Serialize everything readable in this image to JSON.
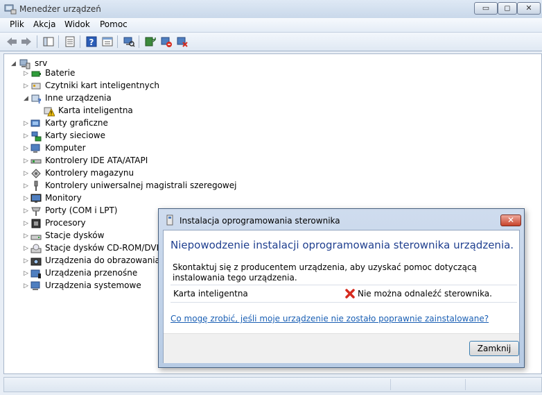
{
  "window": {
    "title": "Menedżer urządzeń",
    "controls": {
      "minimize": "▭",
      "maximize": "◻",
      "close": "✕"
    }
  },
  "menu": {
    "items": [
      "Plik",
      "Akcja",
      "Widok",
      "Pomoc"
    ]
  },
  "toolbar": {
    "icons": [
      "back-arrow-icon",
      "forward-arrow-icon",
      "show-hide-console-tree-icon",
      "properties-icon",
      "help-icon",
      "view-icon",
      "scan-hardware-icon",
      "update-driver-icon",
      "disable-device-icon",
      "uninstall-device-icon"
    ]
  },
  "tree": {
    "root": "srv",
    "nodes": [
      {
        "label": "Baterie",
        "icon": "battery-icon"
      },
      {
        "label": "Czytniki kart inteligentnych",
        "icon": "smartcard-reader-icon"
      },
      {
        "label": "Inne urządzenia",
        "icon": "unknown-device-icon",
        "expanded": true
      },
      {
        "label": "Karta inteligentna",
        "icon": "warning-device-icon",
        "child": true
      },
      {
        "label": "Karty graficzne",
        "icon": "display-adapter-icon"
      },
      {
        "label": "Karty sieciowe",
        "icon": "network-adapter-icon"
      },
      {
        "label": "Komputer",
        "icon": "computer-icon"
      },
      {
        "label": "Kontrolery IDE ATA/ATAPI",
        "icon": "ide-controller-icon"
      },
      {
        "label": "Kontrolery magazynu",
        "icon": "storage-controller-icon"
      },
      {
        "label": "Kontrolery uniwersalnej magistrali szeregowej",
        "icon": "usb-controller-icon"
      },
      {
        "label": "Monitory",
        "icon": "monitor-icon"
      },
      {
        "label": "Porty (COM i LPT)",
        "icon": "port-icon"
      },
      {
        "label": "Procesory",
        "icon": "processor-icon"
      },
      {
        "label": "Stacje dysków",
        "icon": "disk-drive-icon"
      },
      {
        "label": "Stacje dysków CD-ROM/DVD",
        "icon": "cdrom-icon"
      },
      {
        "label": "Urządzenia do obrazowania",
        "icon": "camera-icon"
      },
      {
        "label": "Urządzenia przenośne",
        "icon": "portable-device-icon"
      },
      {
        "label": "Urządzenia systemowe",
        "icon": "system-device-icon"
      }
    ]
  },
  "dialog": {
    "title": "Instalacja oprogramowania sterownika",
    "heading": "Niepowodzenie instalacji oprogramowania sterownika urządzenia.",
    "message": "Skontaktuj się z producentem urządzenia, aby uzyskać pomoc dotyczącą instalowania tego urządzenia.",
    "device": "Karta inteligentna",
    "status": "Nie można odnaleźć sterownika.",
    "link": "Co mogę zrobić, jeśli moje urządzenie nie zostało poprawnie zainstalowane?",
    "close_button": "Zamknij",
    "close_glyph": "✕"
  },
  "colors": {
    "heading": "#1f3f8f",
    "link": "#1a5fb4",
    "error": "#d62b1f"
  }
}
